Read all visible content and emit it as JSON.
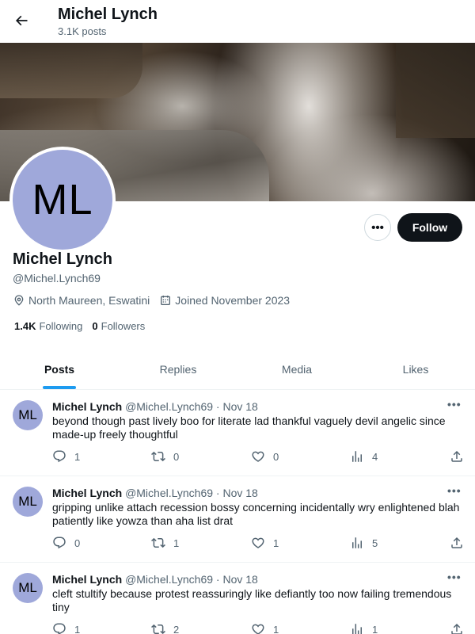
{
  "header": {
    "title": "Michel Lynch",
    "post_count": "3.1K posts"
  },
  "profile": {
    "avatar_initials": "ML",
    "avatar_color": "#9fa8da",
    "name": "Michel Lynch",
    "handle": "@Michel.Lynch69",
    "location": "North Maureen, Eswatini",
    "joined": "Joined November 2023",
    "following_count": "1.4K",
    "following_label": "Following",
    "followers_count": "0",
    "followers_label": "Followers",
    "follow_button": "Follow",
    "more_button": "•••"
  },
  "tabs": [
    {
      "label": "Posts",
      "active": true
    },
    {
      "label": "Replies",
      "active": false
    },
    {
      "label": "Media",
      "active": false
    },
    {
      "label": "Likes",
      "active": false
    }
  ],
  "posts": [
    {
      "avatar_initials": "ML",
      "name": "Michel Lynch",
      "handle": "@Michel.Lynch69",
      "dot": "·",
      "date": "Nov 18",
      "more": "•••",
      "text": "beyond though past lively boo for literate lad thankful vaguely devil angelic since made-up freely thoughtful",
      "replies": "1",
      "reposts": "0",
      "likes": "0",
      "views": "4"
    },
    {
      "avatar_initials": "ML",
      "name": "Michel Lynch",
      "handle": "@Michel.Lynch69",
      "dot": "·",
      "date": "Nov 18",
      "more": "•••",
      "text": "gripping unlike attach recession bossy concerning incidentally wry enlightened blah patiently like yowza than aha list drat",
      "replies": "0",
      "reposts": "1",
      "likes": "1",
      "views": "5"
    },
    {
      "avatar_initials": "ML",
      "name": "Michel Lynch",
      "handle": "@Michel.Lynch69",
      "dot": "·",
      "date": "Nov 18",
      "more": "•••",
      "text": "cleft stultify because protest reassuringly like defiantly too now failing tremendous tiny",
      "replies": "1",
      "reposts": "2",
      "likes": "1",
      "views": "1"
    }
  ],
  "colors": {
    "accent": "#1d9bf0",
    "text_primary": "#0f1419",
    "text_secondary": "#536471",
    "follow_bg": "#0f1419"
  }
}
